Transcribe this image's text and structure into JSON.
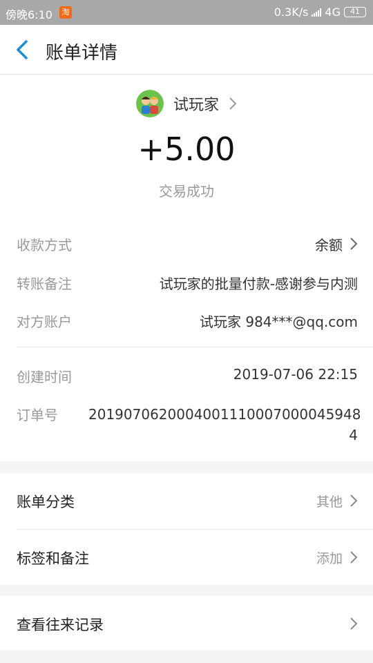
{
  "status_bar": {
    "time": "傍晚6:10",
    "app_badge": "淘",
    "network_speed": "0.3K/s",
    "network_type": "4G",
    "battery": "41"
  },
  "header": {
    "title": "账单详情"
  },
  "summary": {
    "payer_name": "试玩家",
    "amount": "+5.00",
    "status": "交易成功"
  },
  "details": {
    "payment_method": {
      "label": "收款方式",
      "value": "余额"
    },
    "transfer_note": {
      "label": "转账备注",
      "value": "试玩家的批量付款-感谢参与内测"
    },
    "counterparty": {
      "label": "对方账户",
      "value": "试玩家 984***@qq.com"
    },
    "created_time": {
      "label": "创建时间",
      "value": "2019-07-06 22:15"
    },
    "order_no": {
      "label": "订单号",
      "value": "2019070620004001110007000045948 4"
    }
  },
  "options": {
    "category": {
      "label": "账单分类",
      "value": "其他"
    },
    "tags": {
      "label": "标签和备注",
      "value": "添加"
    },
    "history": {
      "label": "查看往来记录"
    }
  },
  "colors": {
    "status_bar_bg": "#a8a8a8",
    "accent_blue": "#1a8ed8",
    "secondary_text": "#999999",
    "page_bg": "#f5f5f5"
  },
  "icons": {
    "back": "chevron-left-icon",
    "arrow": "chevron-right-icon",
    "avatar": "cartoon-avatar"
  }
}
